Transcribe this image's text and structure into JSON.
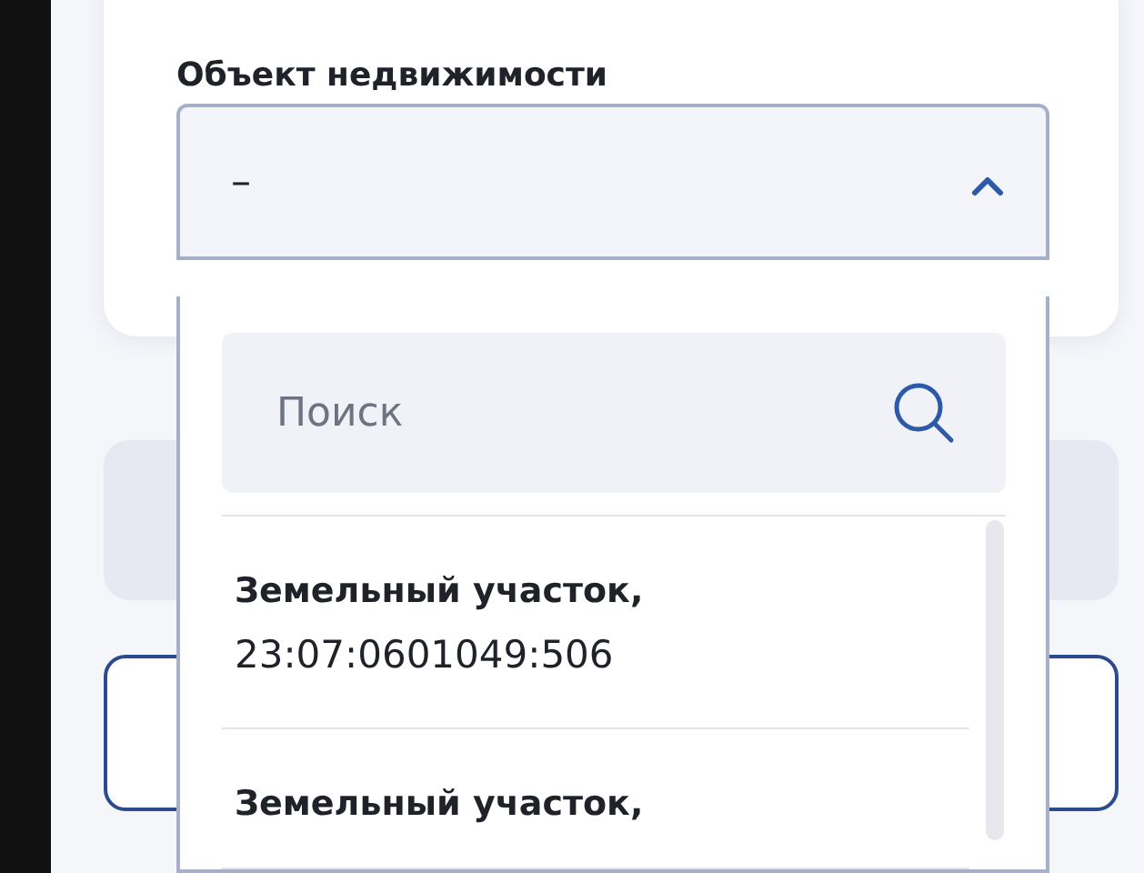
{
  "field": {
    "label": "Объект недвижимости",
    "value": "–",
    "expanded": true
  },
  "dropdown": {
    "search": {
      "placeholder": "Поиск"
    },
    "options": [
      {
        "title": "Земельный участок,",
        "number": "23:07:0601049:506"
      },
      {
        "title": "Земельный участок,"
      }
    ]
  }
}
